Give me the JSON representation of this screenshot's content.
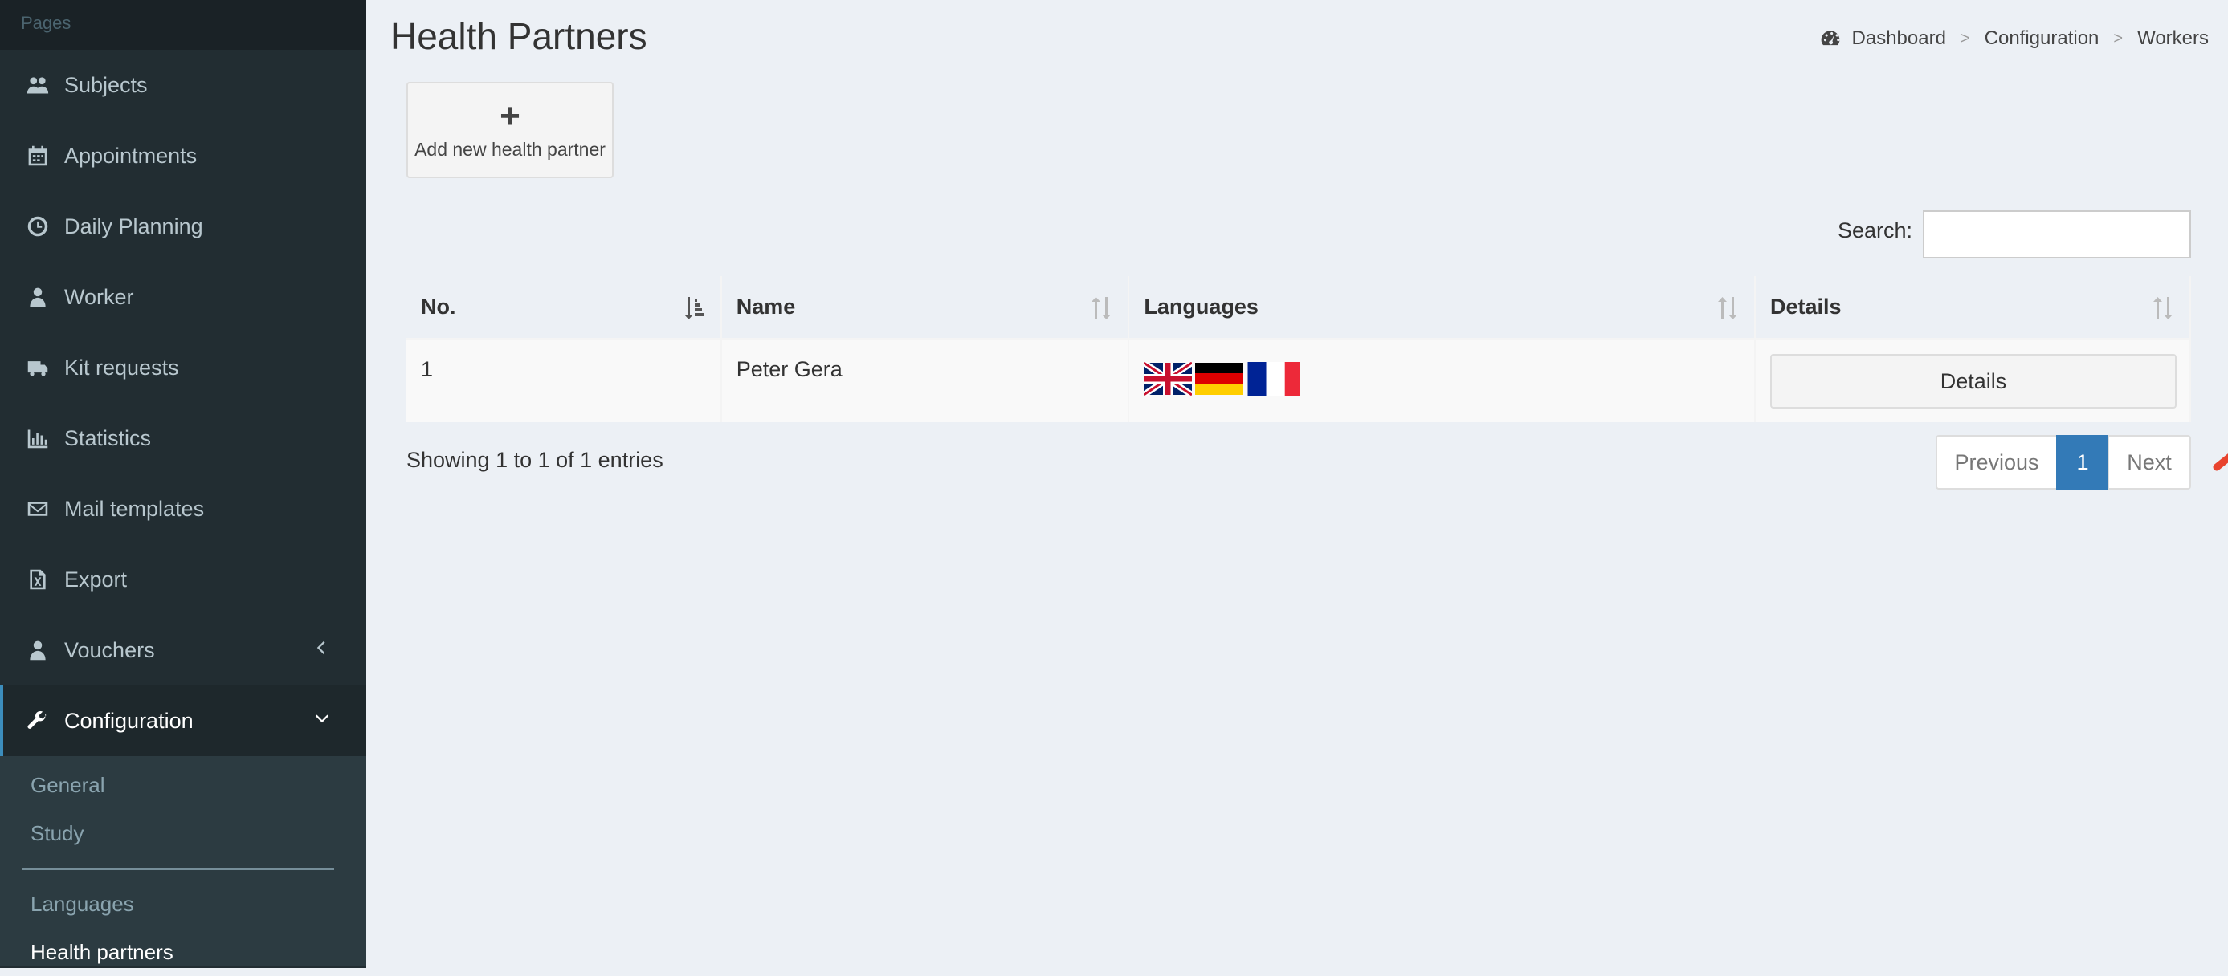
{
  "sidebar": {
    "header": "Pages",
    "items": [
      {
        "label": "Subjects",
        "icon": "users-icon"
      },
      {
        "label": "Appointments",
        "icon": "calendar-icon"
      },
      {
        "label": "Daily Planning",
        "icon": "clock-icon"
      },
      {
        "label": "Worker",
        "icon": "user-md-icon"
      },
      {
        "label": "Kit requests",
        "icon": "truck-icon"
      },
      {
        "label": "Statistics",
        "icon": "bar-chart-icon"
      },
      {
        "label": "Mail templates",
        "icon": "envelope-icon"
      },
      {
        "label": "Export",
        "icon": "file-excel-icon"
      },
      {
        "label": "Vouchers",
        "icon": "user-md-icon"
      },
      {
        "label": "Configuration",
        "icon": "wrench-icon"
      }
    ],
    "submenu": [
      "General",
      "Study",
      "Languages",
      "Health partners"
    ]
  },
  "page": {
    "title": "Health Partners",
    "breadcrumb": [
      "Dashboard",
      "Configuration",
      "Workers"
    ],
    "add_button": "Add new health partner",
    "search_label": "Search:",
    "search_value": ""
  },
  "table": {
    "headers": [
      "No.",
      "Name",
      "Languages",
      "Details"
    ],
    "rows": [
      {
        "no": "1",
        "name": "Peter Gera",
        "languages": [
          "uk-flag",
          "germany-flag",
          "france-flag"
        ],
        "details": "Details"
      }
    ]
  },
  "footer": {
    "info": "Showing 1 to 1 of 1 entries",
    "prev": "Previous",
    "page": "1",
    "next": "Next"
  },
  "colors": {
    "sidebar_bg": "#222d32",
    "accent": "#337ab7",
    "arrow": "#e8432e"
  }
}
